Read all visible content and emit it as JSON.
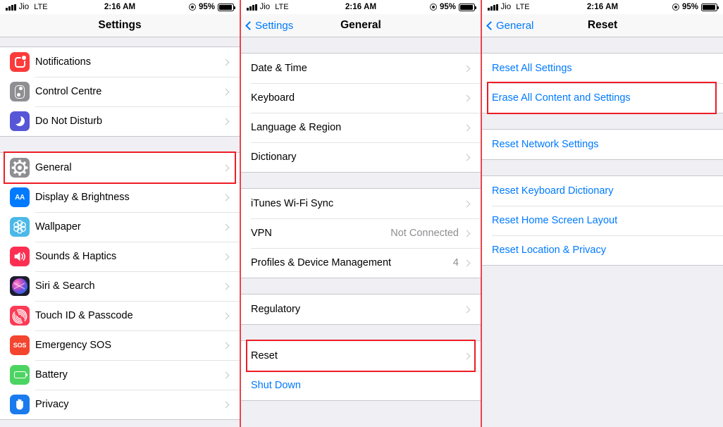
{
  "statusbar": {
    "carrier": "Jio",
    "network": "LTE",
    "time": "2:16 AM",
    "battery_percent": "95%",
    "battery_level": 95,
    "location_icon": "location-arrow-icon",
    "signal_icon": "cellular-bars-icon",
    "battery_icon": "battery-icon"
  },
  "colors": {
    "accent_blue": "#007aff",
    "highlight_red": "#ee1c25",
    "panel_bg": "#efeff4",
    "row_bg": "#ffffff",
    "separator": "#c8c7cc",
    "secondary_text": "#8e8e93"
  },
  "panels": [
    {
      "id": "settings",
      "nav": {
        "title": "Settings",
        "back_label": null
      },
      "sections": [
        {
          "rows": [
            {
              "label": "Notifications",
              "icon": "notifications-icon",
              "icon_class": "i-notif",
              "chevron": true,
              "value": null,
              "highlighted": false
            },
            {
              "label": "Control Centre",
              "icon": "control-centre-icon",
              "icon_class": "i-cc",
              "chevron": true,
              "value": null,
              "highlighted": false
            },
            {
              "label": "Do Not Disturb",
              "icon": "do-not-disturb-icon",
              "icon_class": "i-dnd",
              "chevron": true,
              "value": null,
              "highlighted": false
            }
          ]
        },
        {
          "rows": [
            {
              "label": "General",
              "icon": "general-gear-icon",
              "icon_class": "i-gen",
              "chevron": true,
              "value": null,
              "highlighted": true
            },
            {
              "label": "Display & Brightness",
              "icon": "display-brightness-icon",
              "icon_class": "i-db",
              "chevron": true,
              "value": null,
              "highlighted": false
            },
            {
              "label": "Wallpaper",
              "icon": "wallpaper-icon",
              "icon_class": "i-wp",
              "chevron": true,
              "value": null,
              "highlighted": false
            },
            {
              "label": "Sounds & Haptics",
              "icon": "sounds-haptics-icon",
              "icon_class": "i-snd",
              "chevron": true,
              "value": null,
              "highlighted": false
            },
            {
              "label": "Siri & Search",
              "icon": "siri-search-icon",
              "icon_class": "i-siri",
              "chevron": true,
              "value": null,
              "highlighted": false
            },
            {
              "label": "Touch ID & Passcode",
              "icon": "touch-id-icon",
              "icon_class": "i-touch",
              "chevron": true,
              "value": null,
              "highlighted": false
            },
            {
              "label": "Emergency SOS",
              "icon": "emergency-sos-icon",
              "icon_class": "i-sos",
              "chevron": true,
              "value": null,
              "highlighted": false
            },
            {
              "label": "Battery",
              "icon": "battery-settings-icon",
              "icon_class": "i-batt",
              "chevron": true,
              "value": null,
              "highlighted": false
            },
            {
              "label": "Privacy",
              "icon": "privacy-hand-icon",
              "icon_class": "i-priv",
              "chevron": true,
              "value": null,
              "highlighted": false
            }
          ]
        }
      ]
    },
    {
      "id": "general",
      "nav": {
        "title": "General",
        "back_label": "Settings"
      },
      "sections": [
        {
          "rows": [
            {
              "label": "Date & Time",
              "icon": null,
              "chevron": true,
              "value": null,
              "highlighted": false
            },
            {
              "label": "Keyboard",
              "icon": null,
              "chevron": true,
              "value": null,
              "highlighted": false
            },
            {
              "label": "Language & Region",
              "icon": null,
              "chevron": true,
              "value": null,
              "highlighted": false
            },
            {
              "label": "Dictionary",
              "icon": null,
              "chevron": true,
              "value": null,
              "highlighted": false
            }
          ]
        },
        {
          "rows": [
            {
              "label": "iTunes Wi-Fi Sync",
              "icon": null,
              "chevron": true,
              "value": null,
              "highlighted": false
            },
            {
              "label": "VPN",
              "icon": null,
              "chevron": true,
              "value": "Not Connected",
              "highlighted": false
            },
            {
              "label": "Profiles & Device Management",
              "icon": null,
              "chevron": true,
              "value": "4",
              "highlighted": false
            }
          ]
        },
        {
          "rows": [
            {
              "label": "Regulatory",
              "icon": null,
              "chevron": true,
              "value": null,
              "highlighted": false
            }
          ]
        },
        {
          "rows": [
            {
              "label": "Reset",
              "icon": null,
              "chevron": true,
              "value": null,
              "highlighted": true
            },
            {
              "label": "Shut Down",
              "icon": null,
              "chevron": false,
              "value": null,
              "highlighted": false,
              "blue": true
            }
          ]
        }
      ]
    },
    {
      "id": "reset",
      "nav": {
        "title": "Reset",
        "back_label": "General"
      },
      "sections": [
        {
          "rows": [
            {
              "label": "Reset All Settings",
              "icon": null,
              "chevron": false,
              "value": null,
              "highlighted": false,
              "blue": true
            },
            {
              "label": "Erase All Content and Settings",
              "icon": null,
              "chevron": false,
              "value": null,
              "highlighted": true,
              "blue": true
            }
          ]
        },
        {
          "rows": [
            {
              "label": "Reset Network Settings",
              "icon": null,
              "chevron": false,
              "value": null,
              "highlighted": false,
              "blue": true
            }
          ]
        },
        {
          "rows": [
            {
              "label": "Reset Keyboard Dictionary",
              "icon": null,
              "chevron": false,
              "value": null,
              "highlighted": false,
              "blue": true
            },
            {
              "label": "Reset Home Screen Layout",
              "icon": null,
              "chevron": false,
              "value": null,
              "highlighted": false,
              "blue": true
            },
            {
              "label": "Reset Location & Privacy",
              "icon": null,
              "chevron": false,
              "value": null,
              "highlighted": false,
              "blue": true
            }
          ]
        }
      ]
    }
  ]
}
